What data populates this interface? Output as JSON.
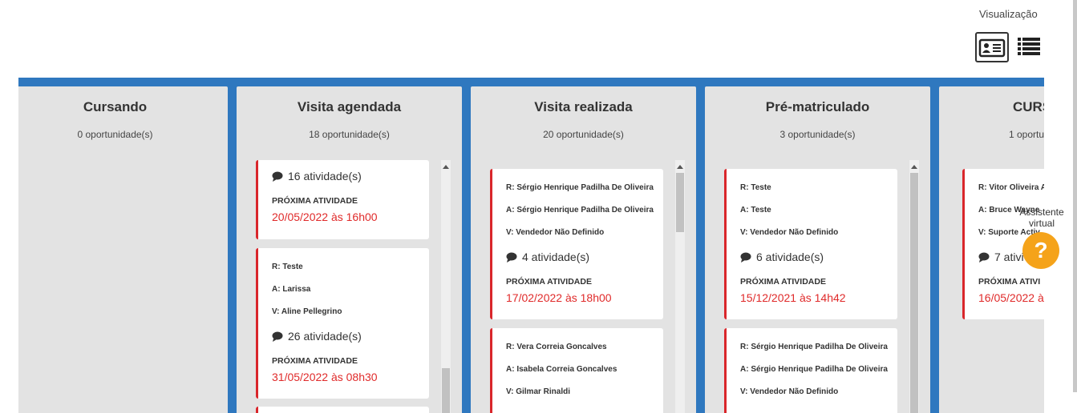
{
  "view": {
    "label": "Visualização",
    "card_icon": "contact-card-icon",
    "list_icon": "list-icon"
  },
  "columns": [
    {
      "title": "Cursando",
      "count": "0 oportunidade(s)"
    },
    {
      "title": "Visita agendada",
      "count": "18 oportunidade(s)"
    },
    {
      "title": "Visita realizada",
      "count": "20 oportunidade(s)"
    },
    {
      "title": "Pré-matriculado",
      "count": "3 oportunidade(s)"
    },
    {
      "title": "CURS",
      "count": "1 oportu"
    }
  ],
  "cards": {
    "agendada_1": {
      "activities": "16 atividade(s)",
      "next_label": "PRÓXIMA ATIVIDADE",
      "next_date": "20/05/2022 às 16h00"
    },
    "agendada_2": {
      "r": "R: Teste",
      "a": "A: Larissa",
      "v": "V: Aline Pellegrino",
      "activities": "26 atividade(s)",
      "next_label": "PRÓXIMA ATIVIDADE",
      "next_date": "31/05/2022 às 08h30"
    },
    "realizada_1": {
      "r": "R: Sérgio Henrique Padilha De Oliveira",
      "a": "A: Sérgio Henrique Padilha De Oliveira",
      "v": "V: Vendedor Não Definido",
      "activities": "4 atividade(s)",
      "next_label": "PRÓXIMA ATIVIDADE",
      "next_date": "17/02/2022 às 18h00"
    },
    "realizada_2": {
      "r": "R: Vera Correia Goncalves",
      "a": "A: Isabela Correia Goncalves",
      "v": "V: Gilmar Rinaldi"
    },
    "pre_1": {
      "r": "R: Teste",
      "a": "A: Teste",
      "v": "V: Vendedor Não Definido",
      "activities": "6 atividade(s)",
      "next_label": "PRÓXIMA ATIVIDADE",
      "next_date": "15/12/2021 às 14h42"
    },
    "pre_2": {
      "r": "R: Sérgio Henrique Padilha De Oliveira",
      "a": "A: Sérgio Henrique Padilha De Oliveira",
      "v": "V: Vendedor Não Definido"
    },
    "curs_1": {
      "r": "R: Vitor Oliveira A",
      "a": "A: Bruce Wayne",
      "v": "V: Suporte Activ",
      "activities": "7 ativi",
      "next_label": "PRÓXIMA ATIVI",
      "next_date": "16/05/2022 à"
    }
  },
  "assistant": {
    "label_line1": "Assistente",
    "label_line2": "virtual",
    "help_glyph": "?"
  },
  "colors": {
    "board": "#2f78bf",
    "column": "#e3e3e3",
    "accent_red": "#d9262b",
    "date_red": "#e02a2a",
    "help_orange": "#f5a31a"
  }
}
